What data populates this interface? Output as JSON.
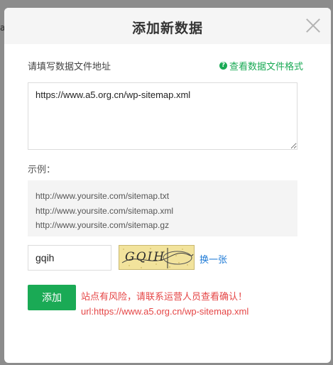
{
  "dialog": {
    "title": "添加新数据",
    "url_label": "请填写数据文件地址",
    "format_link": "查看数据文件格式",
    "url_value": "https://www.a5.org.cn/wp-sitemap.xml",
    "example_label": "示例：",
    "examples": [
      "http://www.yoursite.com/sitemap.txt",
      "http://www.yoursite.com/sitemap.xml",
      "http://www.yoursite.com/sitemap.gz"
    ],
    "captcha_value": "gqih",
    "captcha_image_text": "GQIH",
    "refresh_label": "换一张",
    "add_button": "添加",
    "warning_line1": "站点有风险，请联系运营人员查看确认！",
    "warning_line2": "url:https://www.a5.org.cn/wp-sitemap.xml"
  },
  "icons": {
    "close": "close-icon",
    "help": "help-circle-icon"
  },
  "colors": {
    "accent_green": "#1aaa55",
    "warning_red": "#e54646",
    "link_blue": "#1e7ad6",
    "overlay": "#8c8c8c"
  }
}
